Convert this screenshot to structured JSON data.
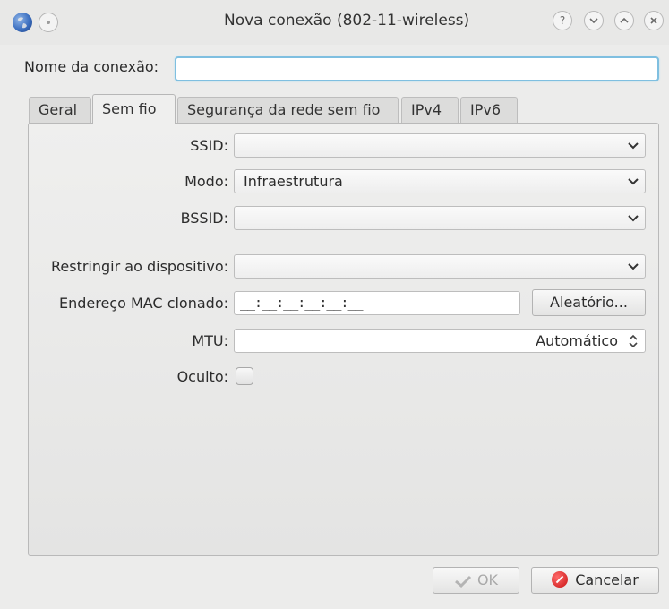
{
  "window": {
    "title": "Nova conexão (802-11-wireless)",
    "app_icon": "globe-icon",
    "buttons": [
      {
        "name": "help-icon",
        "glyph": "?"
      },
      {
        "name": "minimize-icon",
        "glyph": "⌄"
      },
      {
        "name": "maximize-icon",
        "glyph": "⌃"
      },
      {
        "name": "close-icon",
        "glyph": "✕"
      }
    ]
  },
  "connection_name": {
    "label": "Nome da conexão:",
    "value": ""
  },
  "tabs": [
    {
      "label": "Geral",
      "active": false
    },
    {
      "label": "Sem fio",
      "active": true
    },
    {
      "label": "Segurança da rede sem fio",
      "active": false
    },
    {
      "label": "IPv4",
      "active": false
    },
    {
      "label": "IPv6",
      "active": false
    }
  ],
  "form": {
    "ssid": {
      "label": "SSID:",
      "value": ""
    },
    "mode": {
      "label": "Modo:",
      "value": "Infraestrutura"
    },
    "bssid": {
      "label": "BSSID:",
      "value": ""
    },
    "restrict_device": {
      "label": "Restringir ao dispositivo:",
      "value": ""
    },
    "cloned_mac": {
      "label": "Endereço MAC clonado:",
      "value": "__:__:__:__:__:__",
      "random_button": "Aleatório..."
    },
    "mtu": {
      "label": "MTU:",
      "value": "Automático"
    },
    "hidden": {
      "label": "Oculto:",
      "checked": false
    }
  },
  "footer": {
    "ok_label": "OK",
    "cancel_label": "Cancelar"
  },
  "colors": {
    "focus_border": "#7fbfe0",
    "cancel_red": "#c91414"
  }
}
